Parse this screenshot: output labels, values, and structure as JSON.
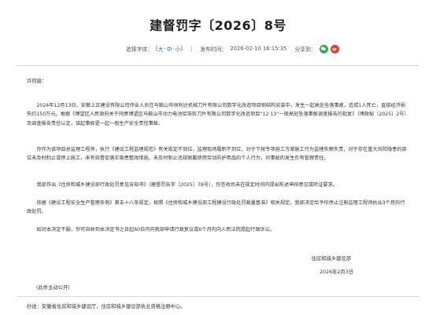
{
  "document": {
    "title": "建督罚字〔2026〕8号",
    "font_size_label": "选择字体：",
    "font_size_open": "[",
    "font_size_options": [
      "大",
      "中",
      "小"
    ],
    "font_size_close": "]",
    "publish_label": "发布时间：",
    "publish_time": "2026-02-10 16:15:35",
    "share_label": "分享到：",
    "share_icons": [
      "wechat-icon",
      "weibo-icon"
    ],
    "salutation": "许何骏：",
    "paragraphs": [
      "2024年12月13日，安徽上正建设有限公司作业人员在马鞍山市恒利达机械刀片有限公司数字化改造项目钢结构安装中，发生一起高处坠落事故，造成1人死亡，直接经济损失约150万元。根据《博望区人民政府关于同意博望区马鞍山市动力电池铝箔剪刀片有限公司数字化改造项目“12·13”一般高处坠落事故调查报告的批复》（博政秘〔2025〕2号）及调查报告责任认定，该起事故是一起一般生产安全责任事故。",
      "你作为该项目总监理工程师，执行《建设工程监理规范》有关规定不到位，监理现场履职不到位，对于下按专项施工方案施工行为监理失察失责，对于存在重大风险隐患的部位未及时制止或停上施工，未有效督促落实隐患整改措施，未及时制止违规佩戴使用劳动防护用品的个人行为，对事故的发生负有管理责任。",
      "我部作出《住房和城乡建设部行政处罚意见告知书》（建督罚告字〔2025〕78号），你签收后未在规定时间内提出陈述申辩意见或听证要求。",
      "依据《建设工程安全生产管理条例》第五十八条规定，按照《住房和城乡建设部工程建设行政处罚裁量基准》相关规定，我部决定给予你停止注册监理工程师执业3个月的行政处罚。",
      "如对本决定不服，你可自收到本决定书之日起60日内向我部申请行政复议或6个月内向人民法院提起行政诉讼。"
    ],
    "signature_org": "住房和城乡建设部",
    "signature_date": "2026年2月3日",
    "public_note": "(此件主动公开)",
    "cc": "抄送：安徽省住房和城乡建设厅，住房和城乡建设部执业资格注册中心。"
  },
  "colors": {
    "link": "#1a6fc2",
    "wechat": "#34a853",
    "weibo": "#e2402c",
    "divider": "#d8d8d8"
  }
}
